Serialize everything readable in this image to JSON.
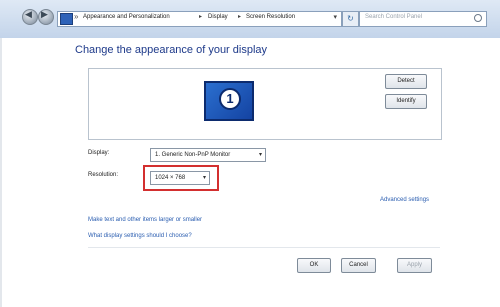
{
  "address_bar": {
    "breadcrumbs": [
      "Appearance and Personalization",
      "Display",
      "Screen Resolution"
    ],
    "search_placeholder": "Search Control Panel"
  },
  "main": {
    "title": "Change the appearance of your display",
    "monitor_number": "1",
    "detect_label": "Detect",
    "identify_label": "Identify",
    "display_label": "Display:",
    "display_value": "1. Generic Non-PnP Monitor",
    "resolution_label": "Resolution:",
    "resolution_value": "1024 × 768",
    "advanced_link": "Advanced settings",
    "links": [
      "Make text and other items larger or smaller",
      "What display settings should I choose?"
    ]
  },
  "footer": {
    "ok_label": "OK",
    "cancel_label": "Cancel",
    "apply_label": "Apply"
  },
  "colors": {
    "accent": "#1e3a8a",
    "link": "#2a5db0",
    "highlight": "#d32f2f"
  }
}
